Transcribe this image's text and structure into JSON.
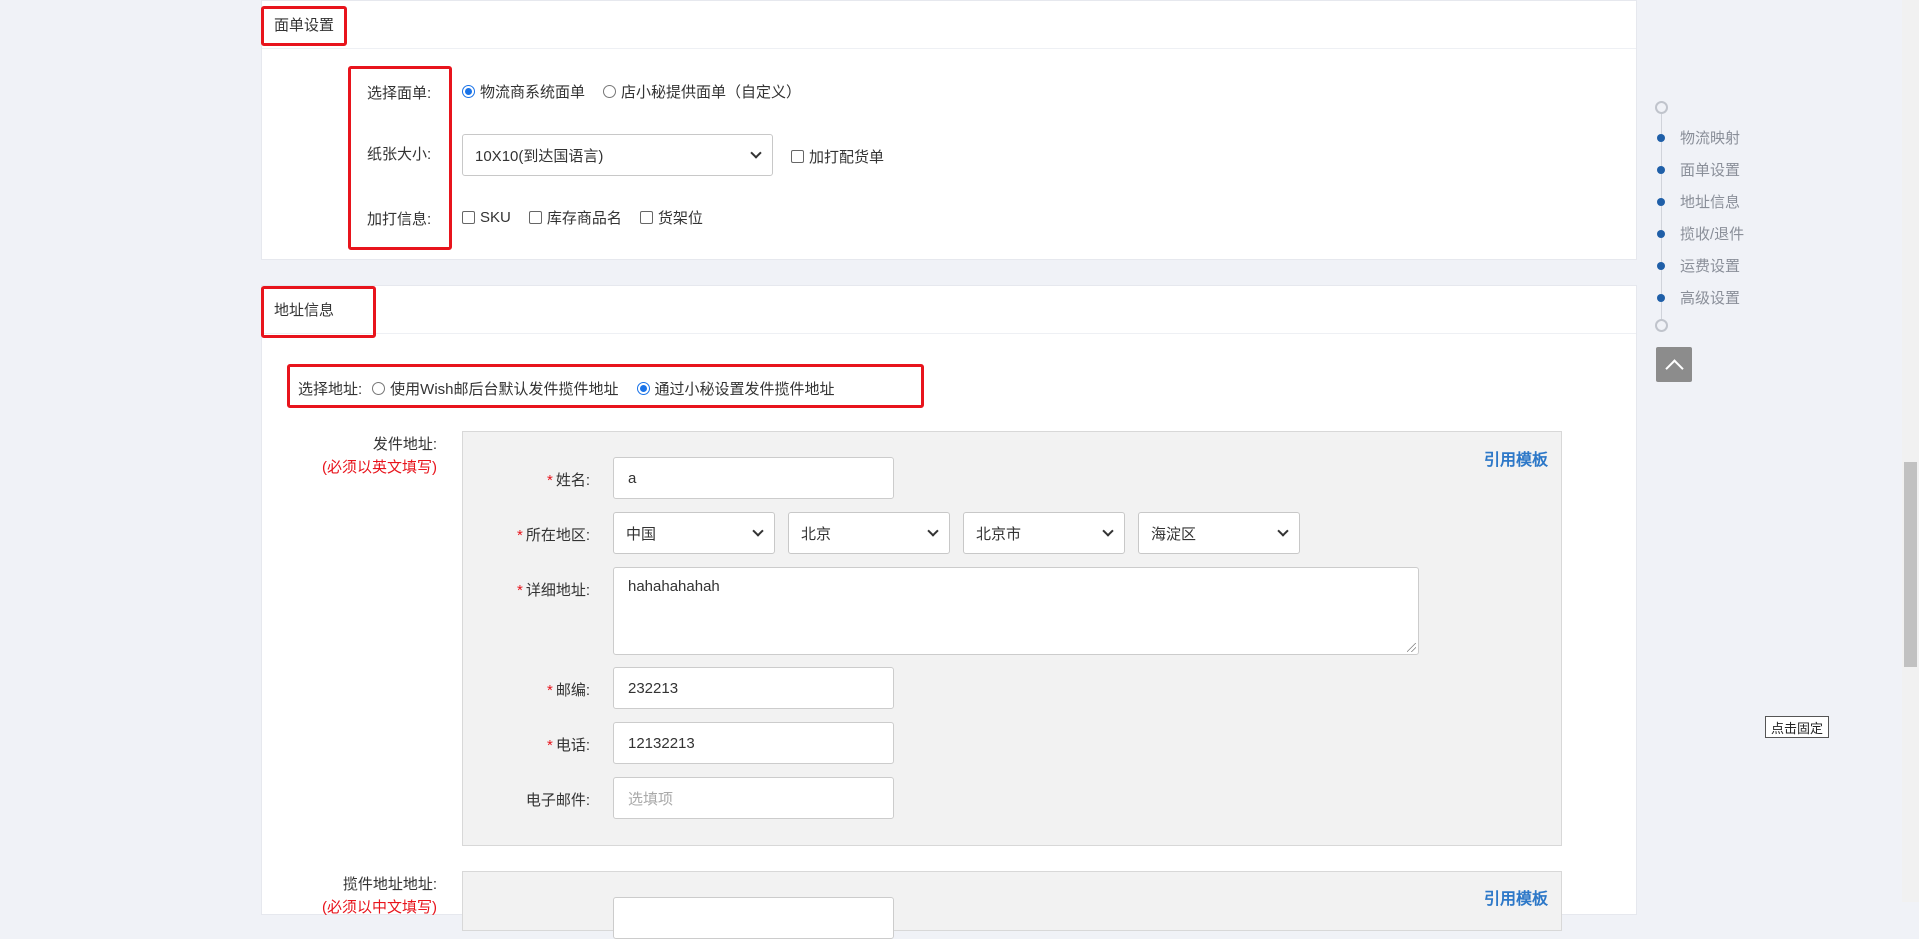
{
  "form_settings": {
    "title": "面单设置",
    "select_form_label": "选择面单:",
    "form_options": [
      {
        "label": "物流商系统面单",
        "selected": true
      },
      {
        "label": "店小秘提供面单（自定义）",
        "selected": false
      }
    ],
    "paper_size_label": "纸张大小:",
    "paper_size_value": "10X10(到达国语言)",
    "add_packing_list_label": "加打配货单",
    "extra_info_label": "加打信息:",
    "extra_info_options": [
      {
        "label": "SKU",
        "checked": false
      },
      {
        "label": "库存商品名",
        "checked": false
      },
      {
        "label": "货架位",
        "checked": false
      }
    ]
  },
  "address_info": {
    "title": "地址信息",
    "select_address_label": "选择地址:",
    "address_options": [
      {
        "label": "使用Wish邮后台默认发件揽件地址",
        "selected": false
      },
      {
        "label": "通过小秘设置发件揽件地址",
        "selected": true
      }
    ],
    "sender": {
      "label": "发件地址:",
      "note": "(必须以英文填写)",
      "use_template": "引用模板",
      "name_label": "姓名:",
      "name_value": "a",
      "region_label": "所在地区:",
      "country": "中国",
      "province": "北京",
      "city": "北京市",
      "district": "海淀区",
      "detail_label": "详细地址:",
      "detail_value": "hahahahahah",
      "zip_label": "邮编:",
      "zip_value": "232213",
      "phone_label": "电话:",
      "phone_value": "12132213",
      "email_label": "电子邮件:",
      "email_placeholder": "选填项"
    },
    "pickup": {
      "label": "揽件地址地址:",
      "note": "(必须以中文填写)",
      "use_template": "引用模板"
    }
  },
  "side_nav": {
    "items": [
      "物流映射",
      "面单设置",
      "地址信息",
      "揽收/退件",
      "运费设置",
      "高级设置"
    ],
    "dot_color": "#1f5fa8",
    "pin_tooltip": "点击固定"
  },
  "colors": {
    "highlight_box": "#e8141c",
    "link": "#2d78c8",
    "radio_accent": "#1a73e8"
  }
}
